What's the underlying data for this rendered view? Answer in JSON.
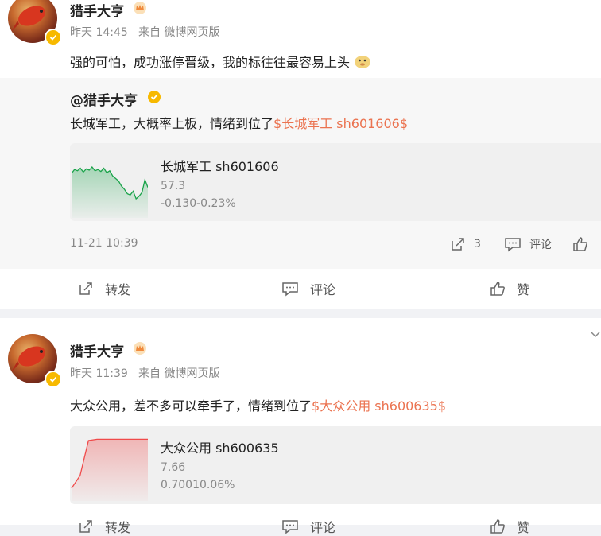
{
  "posts": [
    {
      "author": "猎手大亨",
      "time": "昨天 14:45",
      "source": "来自 微博网页版",
      "text": "强的可怕，成功涨停晋级，我的标往往最容易上头",
      "emoji": "doge-icon",
      "quote": {
        "author": "@猎手大亨",
        "text": "长城军工，大概率上板，情绪到位了",
        "link": "$长城军工 sh601606$",
        "stock": {
          "name": "长城军工 sh601606",
          "price": "57.3",
          "change": "-0.130-0.23%",
          "trend": "down",
          "sparkline": [
            0.7,
            0.76,
            0.74,
            0.78,
            0.72,
            0.77,
            0.75,
            0.8,
            0.74,
            0.76,
            0.73,
            0.78,
            0.71,
            0.74,
            0.66,
            0.62,
            0.58,
            0.5,
            0.45,
            0.38,
            0.36,
            0.42,
            0.3,
            0.34,
            0.4,
            0.6,
            0.48
          ]
        },
        "time": "11-21 10:39",
        "repost_count": "3",
        "comment_label": "评论"
      },
      "actions": {
        "repost": "转发",
        "comment": "评论",
        "like": "赞"
      }
    },
    {
      "author": "猎手大亨",
      "time": "昨天 11:39",
      "source": "来自 微博网页版",
      "text": "大众公用，差不多可以牵手了，情绪到位了",
      "link": "$大众公用 sh600635$",
      "stock": {
        "name": "大众公用 sh600635",
        "price": "7.66",
        "change": "0.70010.06%",
        "trend": "up",
        "sparkline": [
          0.2,
          0.4,
          0.95,
          0.97,
          0.97,
          0.97,
          0.97,
          0.97,
          0.97,
          0.97
        ]
      },
      "actions": {
        "repost": "转发",
        "comment": "评论",
        "like": "赞"
      }
    }
  ],
  "colors": {
    "link": "#eb7350",
    "down": "#1aa34a",
    "up": "#f04a4a",
    "verified": "#f7b900"
  }
}
